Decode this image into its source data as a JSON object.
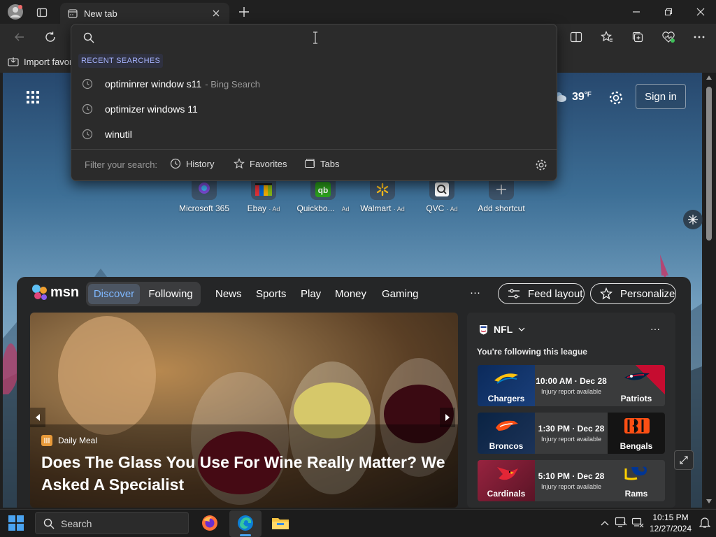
{
  "browser": {
    "tab_title": "New tab",
    "favorites_bar": {
      "import_label": "Import favor"
    }
  },
  "address_dropdown": {
    "section_title": "RECENT SEARCHES",
    "suggestions": [
      {
        "text": "optiminrer window s11",
        "sub": "- Bing Search"
      },
      {
        "text": "optimizer windows 11",
        "sub": ""
      },
      {
        "text": "winutil",
        "sub": ""
      }
    ],
    "filter_label": "Filter your search:",
    "filters": [
      "History",
      "Favorites",
      "Tabs"
    ]
  },
  "newtab": {
    "weather": "39",
    "weather_unit": "°F",
    "sign_in": "Sign in",
    "shortcuts": [
      {
        "label": "Microsoft 365",
        "ad": ""
      },
      {
        "label": "Ebay",
        "ad": "· Ad"
      },
      {
        "label": "Quickbo...",
        "ad": "Ad"
      },
      {
        "label": "Walmart",
        "ad": "· Ad"
      },
      {
        "label": "QVC",
        "ad": "· Ad"
      },
      {
        "label": "Add shortcut",
        "ad": ""
      }
    ]
  },
  "msn": {
    "logo": "msn",
    "tabs": [
      "Discover",
      "Following"
    ],
    "nav": [
      "News",
      "Sports",
      "Play",
      "Money",
      "Gaming"
    ],
    "more": "···",
    "feed_layout": "Feed layout",
    "personalize": "Personalize",
    "hero": {
      "source": "Daily Meal",
      "title": "Does The Glass You Use For Wine Really Matter? We Asked A Specialist"
    },
    "nfl": {
      "title": "NFL",
      "subtitle": "You're following this league",
      "games": [
        {
          "left": "Chargers",
          "right": "Patriots",
          "time": "10:00 AM · Dec 28",
          "note": "Injury report available",
          "left_color": "#0b2a5b",
          "right_color": "#c60c30"
        },
        {
          "left": "Broncos",
          "right": "Bengals",
          "time": "1:30 PM · Dec 28",
          "note": "Injury report available",
          "left_color": "#0a2343",
          "right_color": "#111111"
        },
        {
          "left": "Cardinals",
          "right": "Rams",
          "time": "5:10 PM · Dec 28",
          "note": "Injury report available",
          "left_color": "#97233f",
          "right_color": "#003594"
        }
      ]
    }
  },
  "taskbar": {
    "search_placeholder": "Search",
    "time": "10:15 PM",
    "date": "12/27/2024"
  }
}
